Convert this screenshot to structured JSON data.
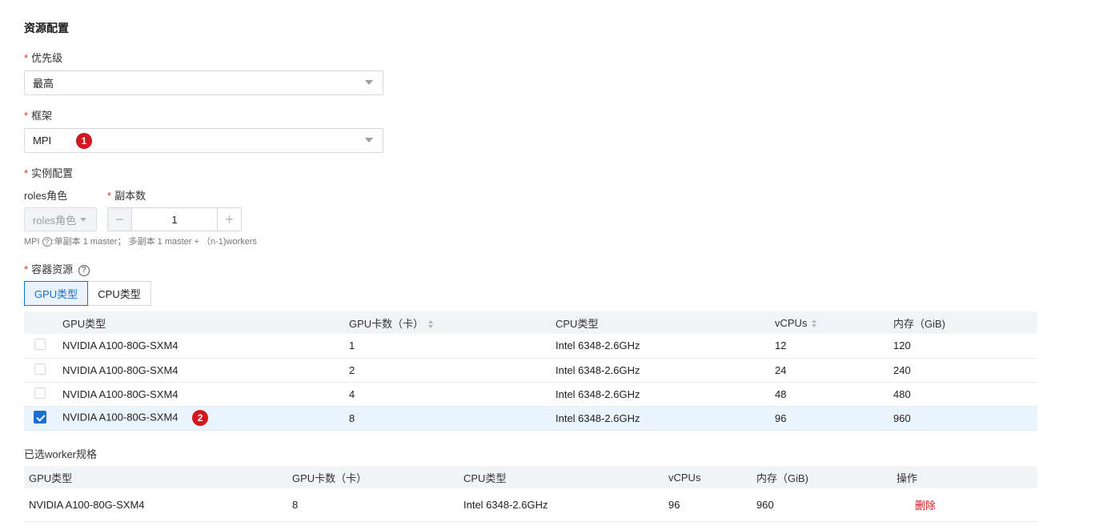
{
  "section_title": "资源配置",
  "priority": {
    "label": "优先级",
    "value": "最高"
  },
  "framework": {
    "label": "框架",
    "value": "MPI",
    "badge": "1"
  },
  "instance": {
    "label": "实例配置",
    "roles_label": "roles角色",
    "roles_value": "roles角色",
    "replicas_label": "副本数",
    "replicas_value": "1",
    "minus": "−",
    "plus": "+",
    "hint_prefix": "MPI",
    "hint_text": ":单副本 1 master； 多副本 1 master + （n-1)workers"
  },
  "container": {
    "label": "容器资源",
    "tabs": [
      {
        "label": "GPU类型",
        "active": true
      },
      {
        "label": "CPU类型",
        "active": false
      }
    ]
  },
  "gpu_table": {
    "headers": [
      "GPU类型",
      "GPU卡数（卡）",
      "CPU类型",
      "vCPUs",
      "内存（GiB)"
    ],
    "rows": [
      {
        "gpu": "NVIDIA A100-80G-SXM4",
        "cards": "1",
        "cpu": "Intel 6348-2.6GHz",
        "vcpus": "12",
        "mem": "120",
        "checked": false
      },
      {
        "gpu": "NVIDIA A100-80G-SXM4",
        "cards": "2",
        "cpu": "Intel 6348-2.6GHz",
        "vcpus": "24",
        "mem": "240",
        "checked": false
      },
      {
        "gpu": "NVIDIA A100-80G-SXM4",
        "cards": "4",
        "cpu": "Intel 6348-2.6GHz",
        "vcpus": "48",
        "mem": "480",
        "checked": false
      },
      {
        "gpu": "NVIDIA A100-80G-SXM4",
        "cards": "8",
        "cpu": "Intel 6348-2.6GHz",
        "vcpus": "96",
        "mem": "960",
        "checked": true,
        "badge": "2"
      }
    ]
  },
  "selected": {
    "title": "已选worker规格",
    "headers": [
      "GPU类型",
      "GPU卡数（卡）",
      "CPU类型",
      "vCPUs",
      "内存（GiB)",
      "操作"
    ],
    "rows": [
      {
        "gpu": "NVIDIA A100-80G-SXM4",
        "cards": "8",
        "cpu": "Intel 6348-2.6GHz",
        "vcpus": "96",
        "mem": "960",
        "action": "删除"
      }
    ]
  },
  "icons": {
    "caret": "caret-down-icon",
    "help": "question-circle-icon",
    "check": "check-icon"
  },
  "colors": {
    "primary": "#1a6fd1",
    "danger": "#d3161f",
    "required": "#e0322b"
  }
}
